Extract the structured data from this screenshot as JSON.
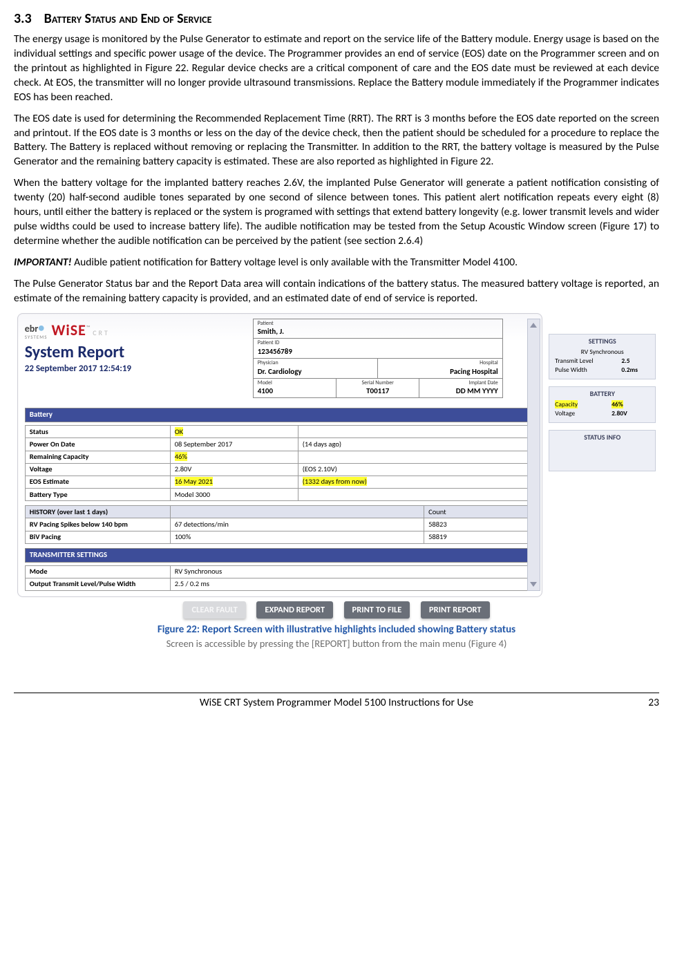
{
  "section": {
    "num": "3.3",
    "title": "Battery Status and End of Service"
  },
  "paras": {
    "p1": "The energy usage is monitored by the Pulse Generator to estimate and report on the service life of the Battery module.  Energy usage is based on the individual settings and specific power usage of the device. The Programmer provides an end of service (EOS) date on the Programmer screen and on the printout as highlighted in Figure 22. Regular device checks are a critical component of care and the EOS date must be reviewed at each device check. At EOS, the transmitter will no longer provide ultrasound transmissions. Replace the Battery module immediately if the Programmer indicates EOS has been reached.",
    "p2": "The EOS date is used for determining the Recommended Replacement Time (RRT). The RRT is 3 months before the EOS date reported on the screen and printout. If the EOS date is 3 months or less on the day of the device check, then the patient should be scheduled for a procedure to replace the Battery.  The Battery is replaced without removing or replacing the Transmitter. In addition to the RRT, the battery voltage is measured by the Pulse Generator and the remaining battery capacity is estimated. These are also reported as highlighted in Figure 22.",
    "p3": "When the battery voltage for the implanted battery reaches 2.6V, the implanted Pulse Generator will generate a patient notification consisting of twenty (20) half-second audible tones separated by one second of silence between tones.  This patient alert notification repeats every eight (8) hours, until either the battery is replaced or the system is programed with settings that extend battery longevity (e.g. lower transmit levels and wider pulse widths could be used to increase battery life). The audible notification may be tested from the Setup Acoustic Window screen (Figure 17) to determine whether the audible notification can be perceived by the patient (see section 2.6.4)",
    "p4a": "IMPORTANT!",
    "p4b": " Audible patient notification for Battery voltage level is only available with the Transmitter Model 4100.",
    "p5": "The Pulse Generator Status bar and the Report Data area will contain indications of the battery status.  The measured battery voltage is reported, an estimate of the remaining battery capacity is provided, and an estimated date of end of service is reported."
  },
  "report": {
    "brand_ebr": "ebr",
    "brand_ebr_sub": "SYSTEMS",
    "brand_wise": "WiSE",
    "brand_wise_sub": "CRT",
    "title": "System Report",
    "datetime": "22 September 2017 12:54:19",
    "patient": {
      "name_label": "Patient",
      "name": "Smith, J.",
      "id_label": "Patient ID",
      "id": "123456789",
      "physician_label": "Physician",
      "physician": "Dr. Cardiology",
      "hospital_label": "Hospital",
      "hospital": "Pacing Hospital",
      "model_label": "Model",
      "model": "4100",
      "serial_label": "Serial Number",
      "serial": "T00117",
      "implant_label": "Implant Date",
      "implant": "DD MM YYYY"
    },
    "battery_header": "Battery",
    "battery_rows": [
      {
        "label": "Status",
        "v1": "OK",
        "v2": "",
        "hl": 1
      },
      {
        "label": "Power On Date",
        "v1": "08 September 2017",
        "v2": "(14 days ago)"
      },
      {
        "label": "Remaining Capacity",
        "v1": "46%",
        "v2": "",
        "hl": 1
      },
      {
        "label": "Voltage",
        "v1": "2.80V",
        "v2": "(EOS 2.10V)"
      },
      {
        "label": "EOS Estimate",
        "v1": "16 May 2021",
        "v2": "(1332 days from now)",
        "hl": 2
      },
      {
        "label": "Battery Type",
        "v1": "Model 3000",
        "v2": ""
      }
    ],
    "history_header": "HISTORY (over last 1 days)",
    "history_count": "Count",
    "history_rows": [
      {
        "label": "RV Pacing Spikes below 140 bpm",
        "v1": "67 detections/min",
        "v2": "58823"
      },
      {
        "label": "BiV Pacing",
        "v1": "100%",
        "v2": "58819"
      }
    ],
    "tx_header": "TRANSMITTER SETTINGS",
    "tx_rows": [
      {
        "label": "Mode",
        "v1": "RV Synchronous"
      },
      {
        "label": "Output Transmit Level/Pulse Width",
        "v1": "2.5 / 0.2 ms"
      }
    ],
    "buttons": {
      "clear": "CLEAR FAULT",
      "expand": "EXPAND REPORT",
      "print_file": "PRINT TO FILE",
      "print": "PRINT REPORT"
    }
  },
  "sidebar": {
    "settings": {
      "title": "SETTINGS",
      "mode": "RV Synchronous",
      "tx_label": "Transmit Level",
      "tx": "2.5",
      "pw_label": "Pulse Width",
      "pw": "0.2ms"
    },
    "battery": {
      "title": "BATTERY",
      "cap_label": "Capacity",
      "cap": "46%",
      "v_label": "Voltage",
      "v": "2.80V"
    },
    "status": {
      "title": "STATUS INFO"
    }
  },
  "caption": {
    "main": "Figure 22: Report Screen with illustrative highlights included showing Battery status",
    "sub": "Screen is accessible by pressing the [REPORT] button from the main menu (Figure 4)"
  },
  "footer": {
    "text": "WiSE CRT System Programmer Model 5100 Instructions for Use",
    "page": "23"
  }
}
